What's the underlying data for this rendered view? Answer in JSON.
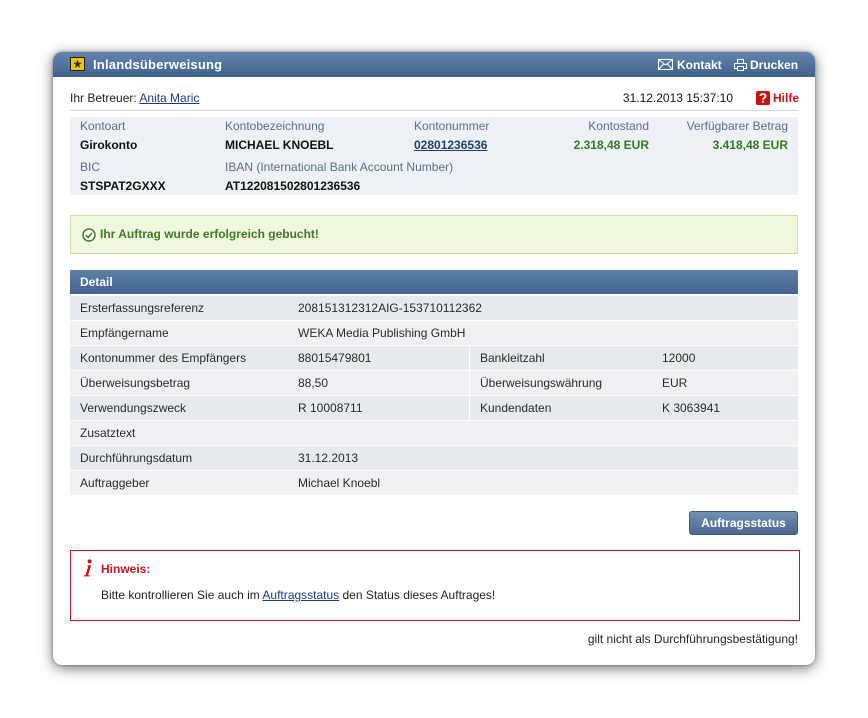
{
  "window": {
    "title": "Inlandsüberweisung",
    "icon": "transfer-icon"
  },
  "header_actions": {
    "contact": {
      "label": "Kontakt",
      "icon": "envelope-icon"
    },
    "print": {
      "label": "Drucken",
      "icon": "printer-icon"
    }
  },
  "advisor": {
    "label": "Ihr Betreuer:",
    "name": "Anita Maric"
  },
  "timestamp": "31.12.2013 15:37:10",
  "help": {
    "label": "Hilfe",
    "icon": "help-icon"
  },
  "account": {
    "type": {
      "label": "Kontoart",
      "value": "Girokonto"
    },
    "name": {
      "label": "Kontobezeichnung",
      "value": "MICHAEL KNOEBL"
    },
    "number": {
      "label": "Kontonummer",
      "value": "02801236536"
    },
    "balance": {
      "label": "Kontostand",
      "value": "2.318,48 EUR"
    },
    "available": {
      "label": "Verfügbarer Betrag",
      "value": "3.418,48 EUR"
    },
    "bic": {
      "label": "BIC",
      "value": "STSPAT2GXXX"
    },
    "iban": {
      "label": "IBAN (International Bank Account Number)",
      "value": "AT122081502801236536"
    }
  },
  "success": {
    "icon": "check-circle-icon",
    "message": "Ihr Auftrag wurde erfolgreich gebucht!"
  },
  "detail": {
    "title": "Detail",
    "rows": [
      {
        "label": "Ersterfassungsreferenz",
        "value": "208151312312AIG-153710112362"
      },
      {
        "label": "Empfängername",
        "value": "WEKA Media Publishing GmbH"
      },
      {
        "label": "Kontonummer des Empfängers",
        "value": "88015479801",
        "label2": "Bankleitzahl",
        "value2": "12000"
      },
      {
        "label": "Überweisungsbetrag",
        "value": "88,50",
        "label2": "Überweisungswährung",
        "value2": "EUR"
      },
      {
        "label": "Verwendungszweck",
        "value": "R 10008711",
        "label2": "Kundendaten",
        "value2": "K 3063941"
      },
      {
        "label": "Zusatztext",
        "value": ""
      },
      {
        "label": "Durchführungsdatum",
        "value": "31.12.2013"
      },
      {
        "label": "Auftraggeber",
        "value": "Michael Knoebl"
      }
    ]
  },
  "actions": {
    "status_button": "Auftragsstatus"
  },
  "notice": {
    "icon": "info-icon",
    "title": "Hinweis:",
    "text_before": "Bitte kontrollieren Sie auch im",
    "link": "Auftragsstatus",
    "text_after": "den Status dieses Auftrages!"
  },
  "footer_note": "gilt nicht als Durchführungsbestätigung!",
  "colors": {
    "header": "#41628a",
    "link": "#1a3a8a",
    "amount_positive": "#2f7d1c",
    "success_text": "#3e7b22",
    "success_bg": "#eff8dd",
    "notice_red": "#c8141e",
    "panel_bg": "#edf1f5"
  }
}
